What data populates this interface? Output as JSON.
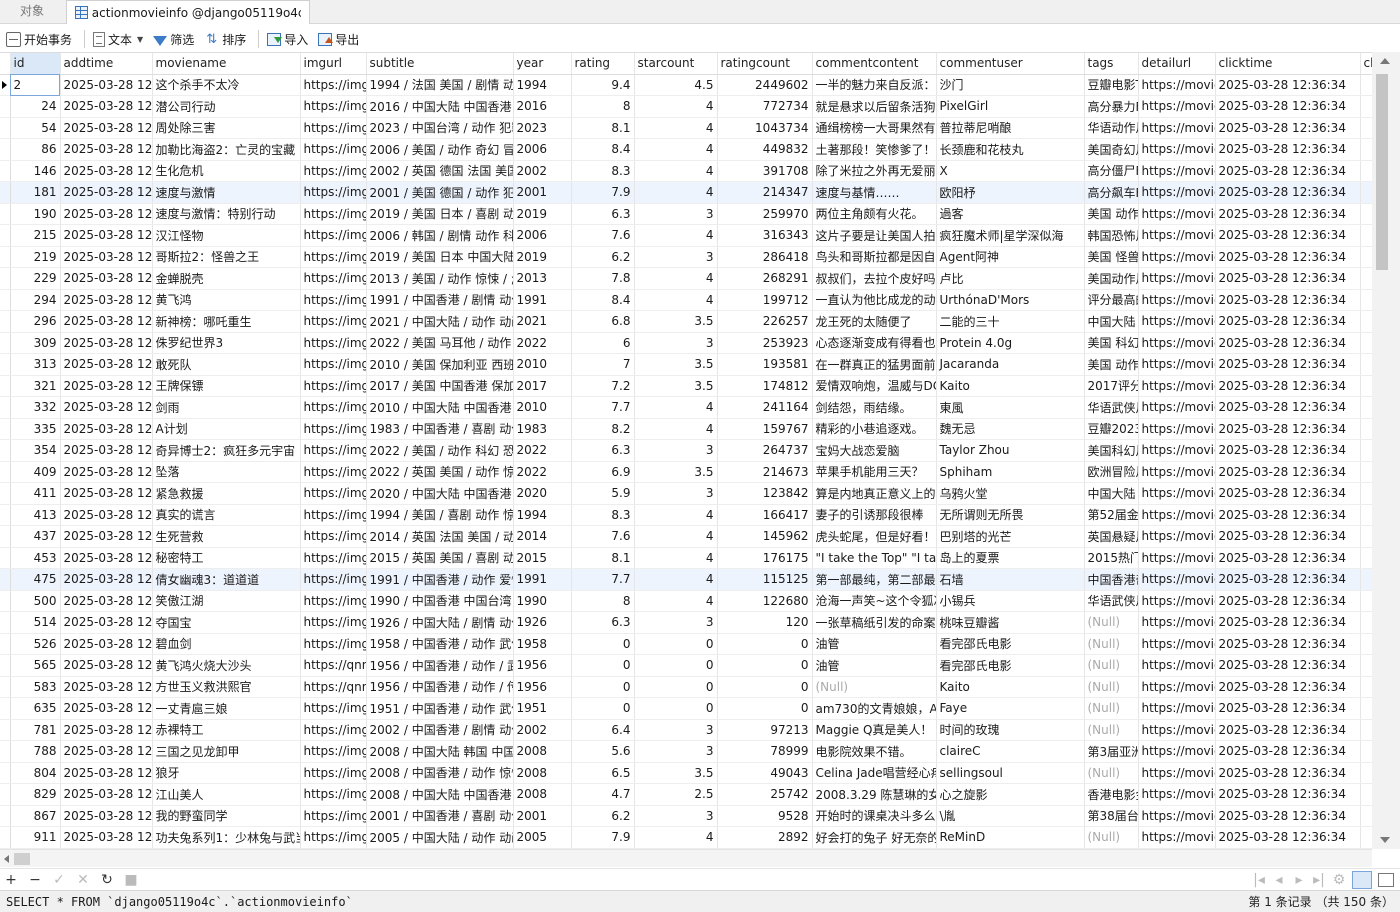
{
  "tabs": {
    "objects": "对象",
    "active": "actionmovieinfo @django05119o4c (..."
  },
  "toolbar": {
    "begin": "开始事务",
    "text": "文本",
    "filter": "筛选",
    "sort": "排序",
    "import": "导入",
    "export": "导出"
  },
  "columns": [
    "id",
    "addtime",
    "moviename",
    "imgurl",
    "subtitle",
    "year",
    "rating",
    "starcount",
    "ratingcount",
    "commentcontent",
    "commentuser",
    "tags",
    "detailurl",
    "clicktime",
    "cl"
  ],
  "rows": [
    [
      "2",
      "2025-03-28 12:3",
      "这个杀手不太冷",
      "https://img",
      "1994 / 法国 美国 / 剧情 动",
      "1994",
      "9.4",
      "4.5",
      "2449602",
      "一半的魅力来自反派：",
      "沙门",
      "豆瓣电影T",
      "https://movie",
      "2025-03-28 12:36:34"
    ],
    [
      "24",
      "2025-03-28 12:3",
      "潜公司行动",
      "https://img",
      "2016 / 中国大陆 中国香港 /",
      "2016",
      "8",
      "4",
      "772734",
      "就是悬求以后留条活狗",
      "PixelGirl",
      "高分暴力F",
      "https://movie",
      "2025-03-28 12:36:34"
    ],
    [
      "54",
      "2025-03-28 12:3",
      "周处除三害",
      "https://img",
      "2023 / 中国台湾 / 动作 犯罪",
      "2023",
      "8.1",
      "4",
      "1043734",
      "通缉榜榜一大哥果然有",
      "普拉蒂尼哨酿",
      "华语动作片",
      "https://movie",
      "2025-03-28 12:36:34"
    ],
    [
      "86",
      "2025-03-28 12:3",
      "加勒比海盗2：亡灵的宝藏",
      "https://img",
      "2006 / 美国 / 动作 奇幻 冒",
      "2006",
      "8.4",
      "4",
      "449832",
      "土著那段！笑惨爹了！！",
      "长颈鹿和花枝丸",
      "美国奇幻片",
      "https://movie",
      "2025-03-28 12:36:34"
    ],
    [
      "146",
      "2025-03-28 12:3",
      "生化危机",
      "https://img",
      "2002 / 英国 德国 法国 美国",
      "2002",
      "8.3",
      "4",
      "391708",
      "除了米拉之外再无爱丽丝",
      "X",
      "高分僵尸F",
      "https://movie",
      "2025-03-28 12:36:34"
    ],
    [
      "181",
      "2025-03-28 12:3",
      "速度与激情",
      "https://img",
      "2001 / 美国 德国 / 动作 犯",
      "2001",
      "7.9",
      "4",
      "214347",
      "速度与基情……",
      "欧阳杼",
      "高分飙车F",
      "https://movie",
      "2025-03-28 12:36:34"
    ],
    [
      "190",
      "2025-03-28 12:3",
      "速度与激情：特别行动",
      "https://img",
      "2019 / 美国 日本 / 喜剧 动",
      "2019",
      "6.3",
      "3",
      "259970",
      "两位主角颇有火花。",
      "過客",
      "美国 动作",
      "https://movie",
      "2025-03-28 12:36:34"
    ],
    [
      "215",
      "2025-03-28 12:3",
      "汉江怪物",
      "https://img",
      "2006 / 韩国 / 剧情 动作 科",
      "2006",
      "7.6",
      "4",
      "316343",
      "这片子要是让美国人拍肯",
      "疯狂魔术师|星学深似海",
      "韩国恐怖片",
      "https://movie",
      "2025-03-28 12:36:34"
    ],
    [
      "219",
      "2025-03-28 12:3",
      "哥斯拉2：怪兽之王",
      "https://img",
      "2019 / 美国 日本 中国大陆",
      "2019",
      "6.2",
      "3",
      "286418",
      "鸟头和哥斯拉都是因自己",
      "Agent阿神",
      "美国 怪兽",
      "https://movie",
      "2025-03-28 12:36:34"
    ],
    [
      "229",
      "2025-03-28 12:3",
      "金蝉脱壳",
      "https://img",
      "2013 / 美国 / 动作 惊悚 / ;",
      "2013",
      "7.8",
      "4",
      "268291",
      "叔叔们，去拉个皮好吗！",
      "卢比",
      "美国动作片",
      "https://movie",
      "2025-03-28 12:36:34"
    ],
    [
      "294",
      "2025-03-28 12:3",
      "黄飞鸿",
      "https://img",
      "1991 / 中国香港 / 剧情 动作",
      "1991",
      "8.4",
      "4",
      "199712",
      "一直认为他比成龙的动作",
      "UrthónaD'Mors",
      "评分最高的",
      "https://movie",
      "2025-03-28 12:36:34"
    ],
    [
      "296",
      "2025-03-28 12:3",
      "新神榜：哪吒重生",
      "https://img",
      "2021 / 中国大陆 / 动作 动画",
      "2021",
      "6.8",
      "3.5",
      "226257",
      "龙王死的太随便了",
      "二能的三十",
      "中国大陆",
      "https://movie",
      "2025-03-28 12:36:34"
    ],
    [
      "309",
      "2025-03-28 12:3",
      "侏罗纪世界3",
      "https://img",
      "2022 / 美国 马耳他 / 动作 ;",
      "2022",
      "6",
      "3",
      "253923",
      "心态逐渐变成有得看也行",
      "Protein 4.0g",
      "美国 科幻",
      "https://movie",
      "2025-03-28 12:36:34"
    ],
    [
      "313",
      "2025-03-28 12:3",
      "敢死队",
      "https://img",
      "2010 / 美国 保加利亚 西班牙",
      "2010",
      "7",
      "3.5",
      "193581",
      "在一群真正的猛男面前，",
      "Jacaranda",
      "美国 动作",
      "https://movie",
      "2025-03-28 12:36:34"
    ],
    [
      "321",
      "2025-03-28 12:3",
      "王牌保镖",
      "https://img",
      "2017 / 美国 中国香港 保加利",
      "2017",
      "7.2",
      "3.5",
      "174812",
      "爱情双响炮，温威与DC",
      "Kaito",
      "2017评分",
      "https://movie",
      "2025-03-28 12:36:34"
    ],
    [
      "332",
      "2025-03-28 12:3",
      "剑雨",
      "https://img",
      "2010 / 中国大陆 中国香港 台",
      "2010",
      "7.7",
      "4",
      "241164",
      "剑结怨，雨结缘。",
      "東風",
      "华语武侠片",
      "https://movie",
      "2025-03-28 12:36:34"
    ],
    [
      "335",
      "2025-03-28 12:3",
      "A计划",
      "https://img",
      "1983 / 中国香港 / 喜剧 动作",
      "1983",
      "8.2",
      "4",
      "159767",
      "精彩的小巷追逐戏。",
      "魏无忌",
      "豆瓣2023",
      "https://movie",
      "2025-03-28 12:36:34"
    ],
    [
      "354",
      "2025-03-28 12:3",
      "奇异博士2：疯狂多元宇宙",
      "https://img",
      "2022 / 美国 / 动作 科幻 恐",
      "2022",
      "6.3",
      "3",
      "264737",
      "宝妈大战恋爱脑",
      "Taylor Zhou",
      "美国科幻片",
      "https://movie",
      "2025-03-28 12:36:34"
    ],
    [
      "409",
      "2025-03-28 12:3",
      "坠落",
      "https://img",
      "2022 / 英国 美国 / 动作 惊",
      "2022",
      "6.9",
      "3.5",
      "214673",
      "苹果手机能用三天？",
      "Sphiham",
      "欧洲冒险片",
      "https://movie",
      "2025-03-28 12:36:34"
    ],
    [
      "411",
      "2025-03-28 12:3",
      "紧急救援",
      "https://img",
      "2020 / 中国大陆 中国香港 /",
      "2020",
      "5.9",
      "3",
      "123842",
      "算是内地真正意义上的",
      "乌鸦火堂",
      "中国大陆",
      "https://movie",
      "2025-03-28 12:36:34"
    ],
    [
      "413",
      "2025-03-28 12:3",
      "真实的谎言",
      "https://img",
      "1994 / 美国 / 喜剧 动作 惊",
      "1994",
      "8.3",
      "4",
      "166417",
      "妻子的引诱那段很棒",
      "无所谓则无所畏",
      "第52届金B",
      "https://movie",
      "2025-03-28 12:36:34"
    ],
    [
      "437",
      "2025-03-28 12:3",
      "生死营救",
      "https://img",
      "2014 / 英国 法国 美国 / 动",
      "2014",
      "7.6",
      "4",
      "145962",
      "虎头蛇尾，但是好看！",
      "巴别塔的光芒",
      "英国悬疑片",
      "https://movie",
      "2025-03-28 12:36:34"
    ],
    [
      "453",
      "2025-03-28 12:3",
      "秘密特工",
      "https://img",
      "2015 / 英国 美国 / 喜剧 动",
      "2015",
      "8.1",
      "4",
      "176175",
      "\"I take the Top\" \"I tak",
      "岛上的夏票",
      "2015热门",
      "https://movie",
      "2025-03-28 12:36:34"
    ],
    [
      "475",
      "2025-03-28 12:3",
      "倩女幽魂3：道道道",
      "https://img",
      "1991 / 中国香港 / 动作 爱情",
      "1991",
      "7.7",
      "4",
      "115125",
      "第一部最纯，第二部最都",
      "石墙",
      "中国香港奇",
      "https://movie",
      "2025-03-28 12:36:34"
    ],
    [
      "500",
      "2025-03-28 12:3",
      "笑傲江湖",
      "https://img",
      "1990 / 中国香港 中国台湾 /",
      "1990",
      "8",
      "4",
      "122680",
      "沧海一声笑~这个令狐冲",
      "小锡兵",
      "华语武侠片",
      "https://movie",
      "2025-03-28 12:36:34"
    ],
    [
      "514",
      "2025-03-28 12:3",
      "夺国宝",
      "https://img",
      "1926 / 中国大陆 / 剧情 动作",
      "1926",
      "6.3",
      "3",
      "120",
      "一张草稿纸引发的命案。",
      "桃味豆瓣酱",
      "(Null)",
      "https://movie",
      "2025-03-28 12:36:34"
    ],
    [
      "526",
      "2025-03-28 12:3",
      "碧血剑",
      "https://img",
      "1958 / 中国香港 / 动作 武侠",
      "1958",
      "0",
      "0",
      "0",
      "油管",
      "看完邵氏电影",
      "(Null)",
      "https://movie",
      "2025-03-28 12:36:34"
    ],
    [
      "565",
      "2025-03-28 12:3",
      "黄飞鸿火烧大沙头",
      "https://qnm",
      "1956 / 中国香港 / 动作 / 武",
      "1956",
      "0",
      "0",
      "0",
      "油管",
      "看完邵氏电影",
      "(Null)",
      "https://movie",
      "2025-03-28 12:36:34"
    ],
    [
      "583",
      "2025-03-28 12:3",
      "方世玉义救洪熙官",
      "https://qnm",
      "1956 / 中国香港 / 动作 / 传",
      "1956",
      "0",
      "0",
      "0",
      "(Null)",
      "Kaito",
      "(Null)",
      "https://movie",
      "2025-03-28 12:36:34"
    ],
    [
      "635",
      "2025-03-28 12:3",
      "一丈青扈三娘",
      "https://img",
      "1951 / 中国香港 / 动作 武侠",
      "1951",
      "0",
      "0",
      "0",
      "am730的文青娘娘，An",
      "Faye",
      "(Null)",
      "https://movie",
      "2025-03-28 12:36:34"
    ],
    [
      "781",
      "2025-03-28 12:3",
      "赤裸特工",
      "https://img",
      "2002 / 中国香港 / 剧情 动作",
      "2002",
      "6.4",
      "3",
      "97213",
      "Maggie Q真是美人！",
      "时间的玫瑰",
      "(Null)",
      "https://movie",
      "2025-03-28 12:36:34"
    ],
    [
      "788",
      "2025-03-28 12:3",
      "三国之见龙卸甲",
      "https://img",
      "2008 / 中国大陆 韩国 中国香",
      "2008",
      "5.6",
      "3",
      "78999",
      "电影院效果不错。",
      "claireC",
      "第3届亚洲",
      "https://movie",
      "2025-03-28 12:36:34"
    ],
    [
      "804",
      "2025-03-28 12:3",
      "狼牙",
      "https://img",
      "2008 / 中国香港 / 动作 惊悚",
      "2008",
      "6.5",
      "3.5",
      "49043",
      "Celina Jade唱营经心疼",
      "sellingsoul",
      "(Null)",
      "https://movie",
      "2025-03-28 12:36:34"
    ],
    [
      "829",
      "2025-03-28 12:3",
      "江山美人",
      "https://img",
      "2008 / 中国大陆 中国香港 /",
      "2008",
      "4.7",
      "2.5",
      "25742",
      "2008.3.29 陈慧琳的女扮",
      "心之旋影",
      "香港电影金",
      "https://movie",
      "2025-03-28 12:36:34"
    ],
    [
      "867",
      "2025-03-28 12:3",
      "我的野蛮同学",
      "https://img",
      "2001 / 中国香港 / 喜剧 动作",
      "2001",
      "6.2",
      "3",
      "9528",
      "开始时的课桌决斗多么乏",
      "\\胤",
      "第38届台北",
      "https://movie",
      "2025-03-28 12:36:34"
    ],
    [
      "911",
      "2025-03-28 12:3",
      "功夫兔系列1：少林兔与武当",
      "https://img",
      "2005 / 中国大陆 / 动作 动画",
      "2005",
      "7.9",
      "4",
      "2892",
      "好会打的兔子 好无奈的",
      "ReMinD",
      "(Null)",
      "https://movie",
      "2025-03-28 12:36:34"
    ]
  ],
  "status": {
    "sql": "SELECT * FROM `django05119o4c`.`actionmovieinfo`",
    "count": "第 1 条记录 （共 150 条）"
  }
}
